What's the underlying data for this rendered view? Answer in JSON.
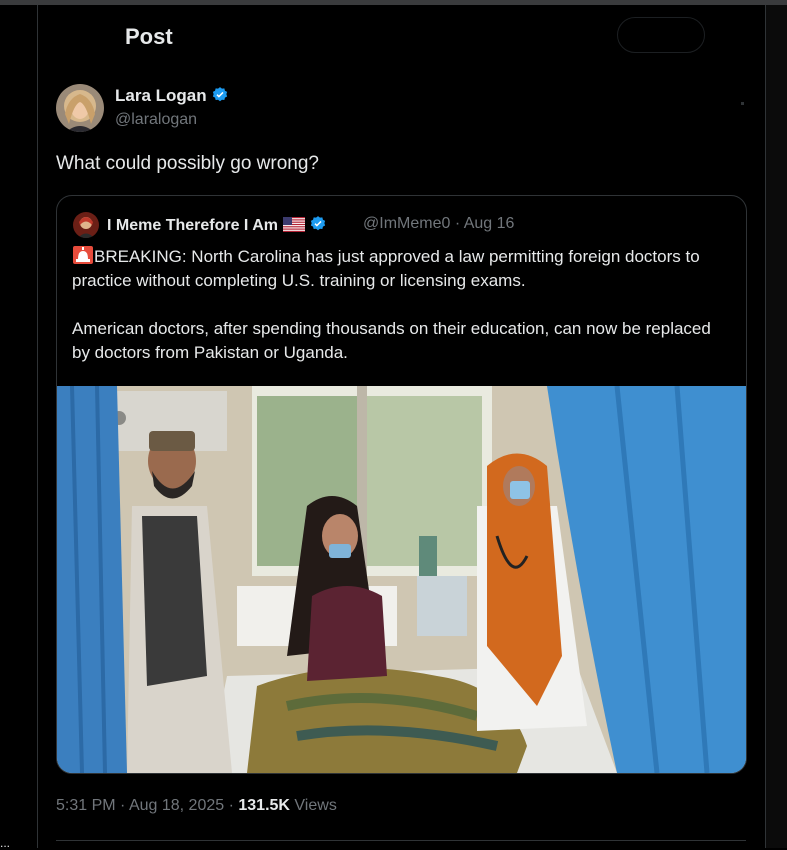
{
  "header": {
    "title": "Post"
  },
  "author": {
    "name": "Lara Logan",
    "handle": "@laralogan"
  },
  "post": {
    "text": "What could possibly go wrong?"
  },
  "quoted": {
    "name": "I Meme Therefore I Am",
    "handle": "@ImMeme0",
    "separator": "·",
    "date": "Aug 16",
    "paragraph1": "BREAKING: North Carolina has just approved a law permitting foreign doctors to practice without completing U.S. training or licensing exams.",
    "paragraph2": "American doctors, after spending thousands on their education, can now be replaced by doctors from Pakistan or Uganda."
  },
  "footer": {
    "time": "5:31 PM",
    "separator": "·",
    "date": "Aug 18, 2025",
    "views_count": "131.5K",
    "views_label": "Views"
  },
  "side": {
    "dots": "..."
  },
  "icons": {
    "verified": "verified-badge-icon",
    "flag": "us-flag-icon",
    "siren": "police-siren-icon"
  },
  "colors": {
    "background": "#000000",
    "text": "#e7e9ea",
    "muted": "#71767b",
    "border": "#2f3336",
    "verified": "#1d9bf0"
  }
}
